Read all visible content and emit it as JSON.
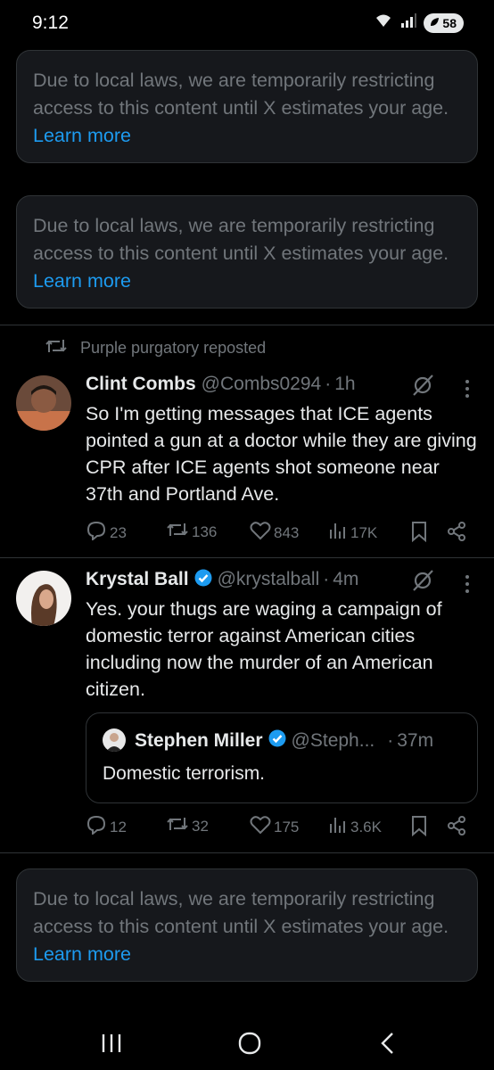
{
  "status_bar": {
    "time": "9:12",
    "signal_label": "6",
    "battery": "58"
  },
  "notice": {
    "text": "Due to local laws, we are temporarily restricting access to this content until X estimates your age.",
    "link": "Learn more"
  },
  "repost": {
    "text": "Purple purgatory reposted"
  },
  "tweet1": {
    "name": "Clint Combs",
    "handle": "@Combs0294",
    "separator": "·",
    "time": "1h",
    "text": "So I'm getting messages that ICE agents pointed a gun at a doctor while they are giving CPR after ICE agents shot someone near 37th and Portland Ave.",
    "replies": "23",
    "reposts": "136",
    "likes": "843",
    "views": "17K"
  },
  "tweet2": {
    "name": "Krystal Ball",
    "handle": "@krystalball",
    "separator": "·",
    "time": "4m",
    "text": "Yes. your thugs are waging a campaign of domestic terror against American cities including now the murder of an American citizen.",
    "replies": "12",
    "reposts": "32",
    "likes": "175",
    "views": "3.6K",
    "quote": {
      "name": "Stephen Miller",
      "handle": "@Steph...",
      "separator": "·",
      "time": "37m",
      "text": "Domestic terrorism."
    }
  },
  "colors": {
    "background": "#000000",
    "card": "#16181c",
    "border": "#2f3336",
    "muted": "#71767b",
    "link": "#1d9bf0",
    "verified": "#1d9bf0"
  }
}
